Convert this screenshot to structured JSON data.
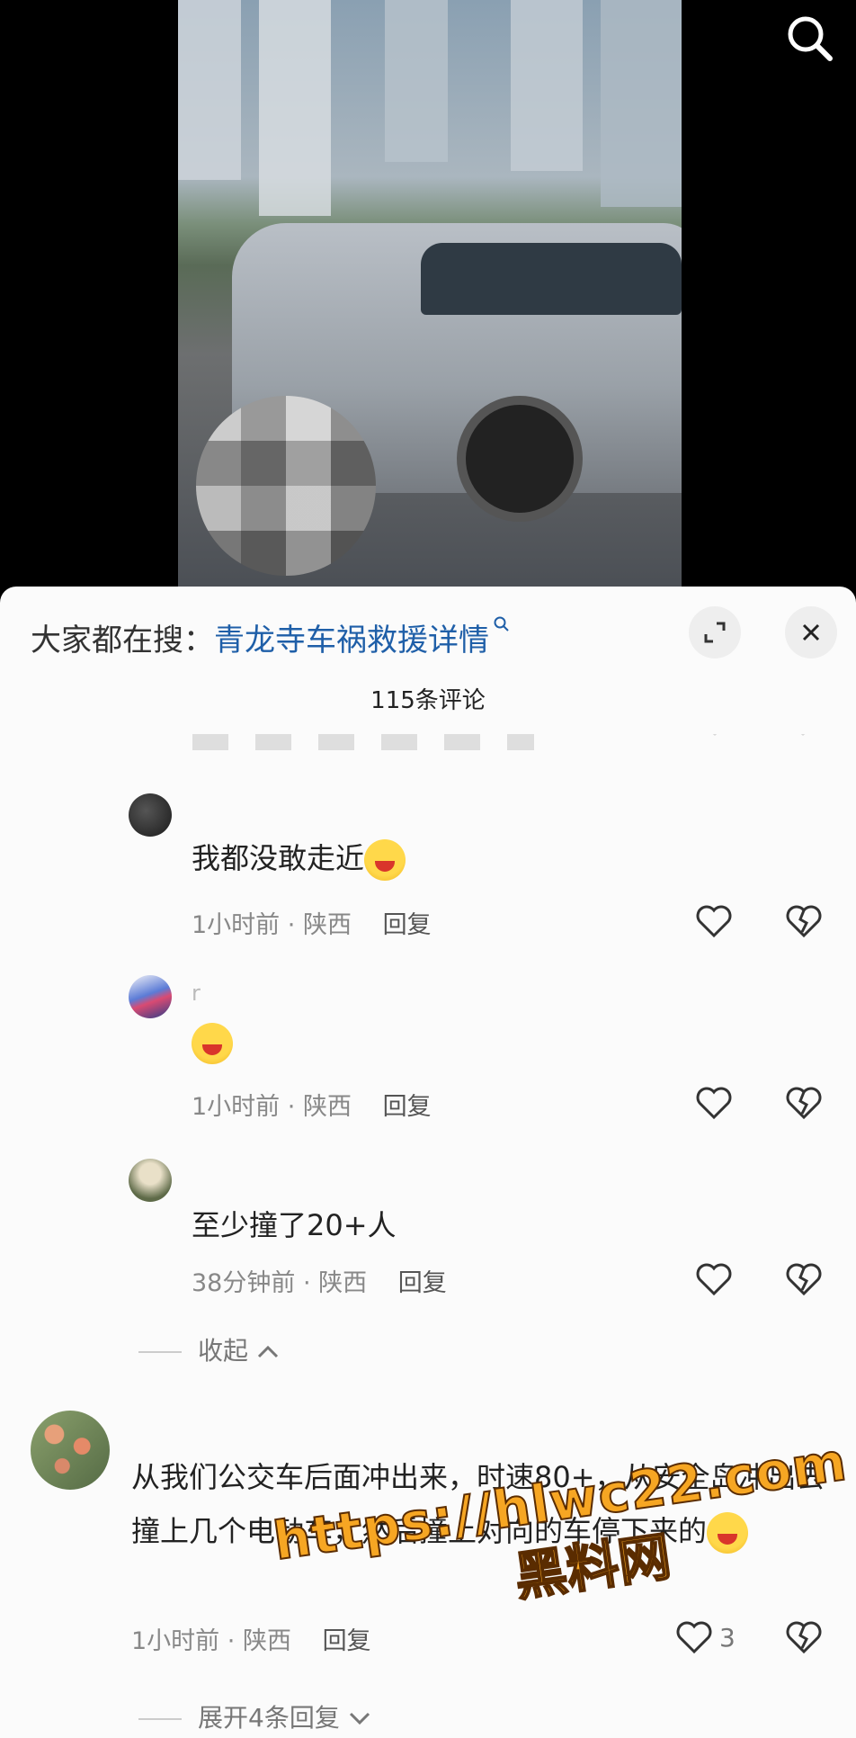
{
  "video": {
    "search_icon": "search-icon"
  },
  "sheet": {
    "hint_prefix": "大家都在搜：",
    "hint_link": "青龙寺车祸救援详情",
    "expand_icon": "expand-icon",
    "close_icon": "close-icon",
    "comment_count": "115条评论"
  },
  "comments": [
    {
      "text": "我都没敢走近",
      "has_emoji": true,
      "time": "1小时前",
      "location": "陕西",
      "reply": "回复",
      "likes": ""
    },
    {
      "name_partial": "r",
      "text": "",
      "has_emoji": true,
      "time": "1小时前",
      "location": "陕西",
      "reply": "回复",
      "likes": ""
    },
    {
      "text": "至少撞了20+人",
      "has_emoji": false,
      "time": "38分钟前",
      "location": "陕西",
      "reply": "回复",
      "likes": ""
    },
    {
      "text": "从我们公交车后面冲出来，时速80+，从安全岛冲出去撞上几个电动车，然后撞上对向的",
      "text_end": "车停下来的",
      "has_emoji": true,
      "time": "1小时前",
      "location": "陕西",
      "reply": "回复",
      "likes": "3"
    }
  ],
  "collapse_label": "收起",
  "expand_replies_label": "展开4条回复",
  "meta_sep": "·",
  "watermark": {
    "url": "https://hlwc22.com",
    "name": "黑料网"
  }
}
